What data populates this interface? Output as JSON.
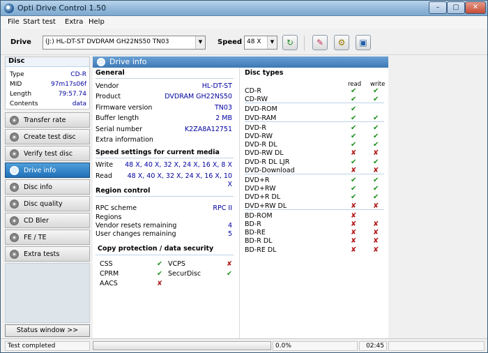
{
  "window": {
    "title": "Opti Drive Control 1.50",
    "min": "–",
    "max": "▢",
    "close": "✕"
  },
  "menu": [
    "File",
    "Start test",
    "Extra",
    "Help"
  ],
  "toolbar": {
    "drive_label": "Drive",
    "drive_value": "(J:)  HL-DT-ST DVDRAM GH22NS50 TN03",
    "speed_label": "Speed",
    "speed_value": "48 X",
    "refresh_icon": "↻",
    "eraser_icon": "✎",
    "settings_icon": "⚙",
    "save_icon": "▣"
  },
  "disc": {
    "title": "Disc",
    "rows": [
      {
        "label": "Type",
        "value": "CD-R"
      },
      {
        "label": "MID",
        "value": "97m17s06f"
      },
      {
        "label": "Length",
        "value": "79:57.74"
      },
      {
        "label": "Contents",
        "value": "data"
      }
    ]
  },
  "nav": [
    "Transfer rate",
    "Create test disc",
    "Verify test disc",
    "Drive info",
    "Disc info",
    "Disc quality",
    "CD Bler",
    "FE / TE",
    "Extra tests"
  ],
  "status_button": "Status window >>",
  "main": {
    "header": "Drive info",
    "general_title": "General",
    "general": [
      {
        "label": "Vendor",
        "value": "HL-DT-ST"
      },
      {
        "label": "Product",
        "value": "DVDRAM GH22NS50"
      },
      {
        "label": "Firmware version",
        "value": "TN03"
      },
      {
        "label": "Buffer length",
        "value": "2 MB"
      },
      {
        "label": "Serial number",
        "value": "K2ZA8A12751"
      },
      {
        "label": "Extra information",
        "value": ""
      }
    ],
    "speed_title": "Speed settings for current media",
    "write_label": "Write",
    "write_value": "48 X, 40 X, 32 X, 24 X, 16 X, 8 X",
    "read_label": "Read",
    "read_value": "48 X, 40 X, 32 X, 24 X, 16 X, 10",
    "read_value_cont": "X",
    "region_title": "Region control",
    "region": [
      {
        "label": "RPC scheme",
        "value": "RPC II"
      },
      {
        "label": "Regions",
        "value": ""
      },
      {
        "label": "Vendor resets remaining",
        "value": "4"
      },
      {
        "label": "User changes remaining",
        "value": "5"
      }
    ],
    "copy_title": "Copy protection / data security",
    "copy_left": [
      {
        "name": "CSS",
        "supported": true
      },
      {
        "name": "CPRM",
        "supported": true
      },
      {
        "name": "AACS",
        "supported": false
      }
    ],
    "copy_right": [
      {
        "name": "VCPS",
        "supported": false
      },
      {
        "name": "SecurDisc",
        "supported": true
      }
    ],
    "disc_types_title": "Disc types",
    "read_col": "read",
    "write_col": "write",
    "disc_types": [
      {
        "name": "CD-R",
        "read": true,
        "write": true,
        "sep": false
      },
      {
        "name": "CD-RW",
        "read": true,
        "write": true,
        "sep": false
      },
      {
        "name": "DVD-ROM",
        "read": true,
        "write": null,
        "sep": true
      },
      {
        "name": "DVD-RAM",
        "read": true,
        "write": true,
        "sep": false
      },
      {
        "name": "DVD-R",
        "read": true,
        "write": true,
        "sep": true
      },
      {
        "name": "DVD-RW",
        "read": true,
        "write": true,
        "sep": false
      },
      {
        "name": "DVD-R DL",
        "read": true,
        "write": true,
        "sep": false
      },
      {
        "name": "DVD-RW DL",
        "read": false,
        "write": false,
        "sep": false
      },
      {
        "name": "DVD-R DL LJR",
        "read": true,
        "write": true,
        "sep": false
      },
      {
        "name": "DVD-Download",
        "read": false,
        "write": false,
        "sep": false
      },
      {
        "name": "DVD+R",
        "read": true,
        "write": true,
        "sep": true
      },
      {
        "name": "DVD+RW",
        "read": true,
        "write": true,
        "sep": false
      },
      {
        "name": "DVD+R DL",
        "read": true,
        "write": true,
        "sep": false
      },
      {
        "name": "DVD+RW DL",
        "read": false,
        "write": false,
        "sep": false
      },
      {
        "name": "BD-ROM",
        "read": false,
        "write": null,
        "sep": true
      },
      {
        "name": "BD-R",
        "read": false,
        "write": false,
        "sep": false
      },
      {
        "name": "BD-RE",
        "read": false,
        "write": false,
        "sep": false
      },
      {
        "name": "BD-R DL",
        "read": false,
        "write": false,
        "sep": false
      },
      {
        "name": "BD-RE DL",
        "read": false,
        "write": false,
        "sep": false
      }
    ]
  },
  "statusbar": {
    "text": "Test completed",
    "progress_percent": "0.0%",
    "progress_fraction": 0,
    "time": "02:45"
  },
  "colors": {
    "ok": "#1a8f1a",
    "no": "#b21b1b",
    "accent": "#3d78b5"
  }
}
